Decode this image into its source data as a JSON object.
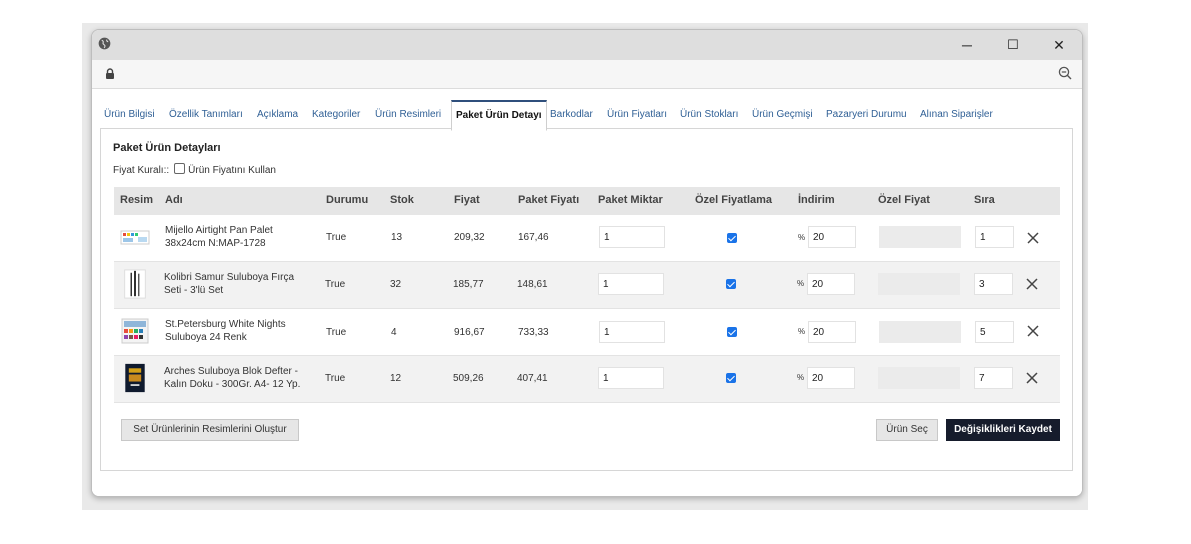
{
  "window": {
    "controls": {
      "minimize": "─",
      "maximize": "☐",
      "close": "✕"
    }
  },
  "tabs": [
    "Ürün Bilgisi",
    "Özellik Tanımları",
    "Açıklama",
    "Kategoriler",
    "Ürün Resimleri",
    "Paket Ürün Detayı",
    "Barkodlar",
    "Ürün Fiyatları",
    "Ürün Stokları",
    "Ürün Geçmişi",
    "Pazaryeri Durumu",
    "Alınan Siparişler"
  ],
  "active_tab": "Paket Ürün Detayı",
  "panel": {
    "title": "Paket Ürün Detayları",
    "price_rule_label": "Fiyat Kuralı::",
    "price_rule_checkbox_label": "Ürün Fiyatını Kullan"
  },
  "table": {
    "headers": [
      "Resim",
      "Adı",
      "Durumu",
      "Stok",
      "Fiyat",
      "Paket Fiyatı",
      "Paket Miktar",
      "Özel Fiyatlama",
      "İndirim",
      "Özel Fiyat",
      "Sıra"
    ],
    "discount_symbol": "%",
    "rows": [
      {
        "name_line1": "Mijello Airtight Pan Palet",
        "name_line2": "38x24cm N:MAP-1728",
        "status": "True",
        "stock": "13",
        "price": "209,32",
        "package_price": "167,46",
        "package_qty": "1",
        "special_pricing": true,
        "discount": "20",
        "special_price": "",
        "order": "1"
      },
      {
        "name_line1": "Kolibri Samur Suluboya Fırça",
        "name_line2": "Seti - 3'lü Set",
        "status": "True",
        "stock": "32",
        "price": "185,77",
        "package_price": "148,61",
        "package_qty": "1",
        "special_pricing": true,
        "discount": "20",
        "special_price": "",
        "order": "3"
      },
      {
        "name_line1": "St.Petersburg White Nights",
        "name_line2": "Suluboya 24 Renk",
        "status": "True",
        "stock": "4",
        "price": "916,67",
        "package_price": "733,33",
        "package_qty": "1",
        "special_pricing": true,
        "discount": "20",
        "special_price": "",
        "order": "5"
      },
      {
        "name_line1": "Arches Suluboya Blok Defter -",
        "name_line2": "Kalın Doku - 300Gr. A4- 12 Yp.",
        "status": "True",
        "stock": "12",
        "price": "509,26",
        "package_price": "407,41",
        "package_qty": "1",
        "special_pricing": true,
        "discount": "20",
        "special_price": "",
        "order": "7"
      }
    ]
  },
  "buttons": {
    "create_images": "Set Ürünlerinin Resimlerini Oluştur",
    "select_product": "Ürün Seç",
    "save_changes": "Değişiklikleri Kaydet"
  },
  "colors": {
    "accent": "#1a73e8",
    "tab_link": "#2f5f95",
    "dark_button": "#161c2c"
  }
}
